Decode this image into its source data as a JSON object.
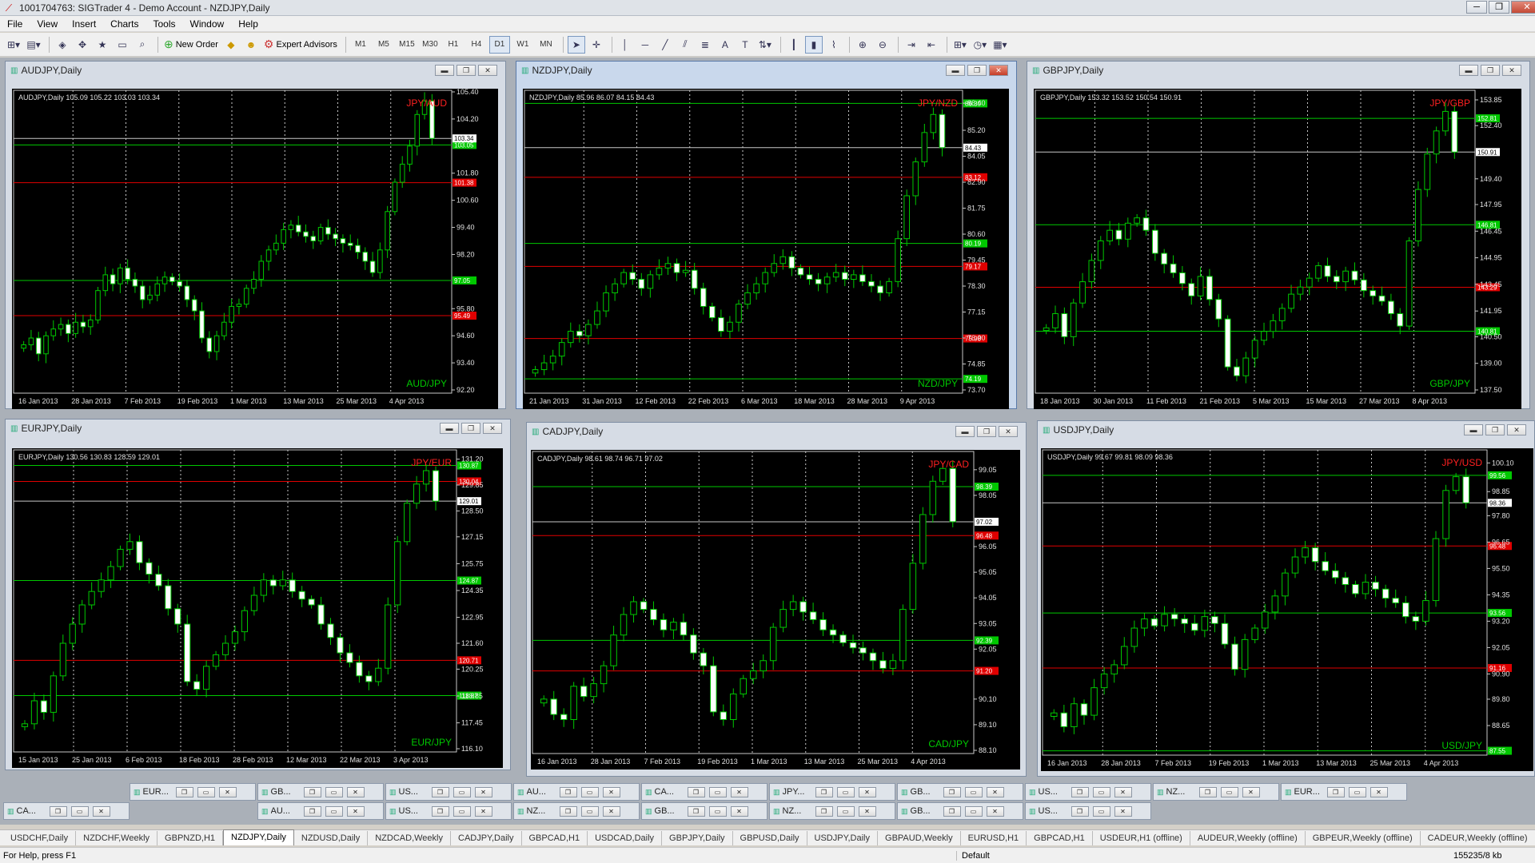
{
  "app": {
    "title": "1001704763: SIGTrader 4 - Demo Account - NZDJPY,Daily",
    "window_buttons": [
      "─",
      "❐",
      "✕"
    ]
  },
  "menu": [
    "File",
    "View",
    "Insert",
    "Charts",
    "Tools",
    "Window",
    "Help"
  ],
  "toolbar": {
    "new_order": "New Order",
    "expert_advisors": "Expert Advisors",
    "timeframes": [
      "M1",
      "M5",
      "M15",
      "M30",
      "H1",
      "H4",
      "D1",
      "W1",
      "MN"
    ],
    "active_timeframe": "D1"
  },
  "charts": [
    {
      "title": "AUDJPY,Daily",
      "info": "AUDJPY,Daily  105.09 105.22 103.03 103.34",
      "top_label": "JPY/AUD",
      "bottom_label": "AUD/JPY",
      "yticks": [
        "105.40",
        "104.20",
        "101.80",
        "100.60",
        "99.40",
        "98.20",
        "95.80",
        "94.60",
        "93.40",
        "92.20"
      ],
      "xticks": [
        "16 Jan 2013",
        "28 Jan 2013",
        "7 Feb 2013",
        "19 Feb 2013",
        "1 Mar 2013",
        "13 Mar 2013",
        "25 Mar 2013",
        "4 Apr 2013"
      ],
      "hlines": [
        {
          "v": "103.05",
          "c": "#00c800"
        },
        {
          "v": "101.38",
          "c": "#e00000"
        },
        {
          "v": "97.05",
          "c": "#00c800"
        },
        {
          "v": "95.49",
          "c": "#e00000"
        }
      ],
      "last": "103.34",
      "ymin": 92.2,
      "ymax": 105.4,
      "closes": [
        94.2,
        94.5,
        93.8,
        94.6,
        94.9,
        95.1,
        94.7,
        95.2,
        95.0,
        95.3,
        96.6,
        97.3,
        96.9,
        97.6,
        97.1,
        96.8,
        96.2,
        96.4,
        96.9,
        97.2,
        97.0,
        96.8,
        96.2,
        95.7,
        94.5,
        93.9,
        94.6,
        95.2,
        95.9,
        96.0,
        96.7,
        97.1,
        97.9,
        98.4,
        98.7,
        99.3,
        99.5,
        99.2,
        99.0,
        98.8,
        99.4,
        99.1,
        98.9,
        98.7,
        98.6,
        98.3,
        97.9,
        97.4,
        98.4,
        100.1,
        101.4,
        102.2,
        103.0,
        104.4,
        105.0,
        103.34
      ]
    },
    {
      "title": "NZDJPY,Daily",
      "info": "NZDJPY,Daily  85.96 86.07 84.15 84.43",
      "top_label": "JPY/NZD",
      "bottom_label": "NZD/JPY",
      "yticks": [
        "86.40",
        "85.20",
        "84.05",
        "82.90",
        "81.75",
        "80.60",
        "79.45",
        "78.30",
        "77.15",
        "76.00",
        "74.85",
        "73.70"
      ],
      "xticks": [
        "21 Jan 2013",
        "31 Jan 2013",
        "12 Feb 2013",
        "22 Feb 2013",
        "6 Mar 2013",
        "18 Mar 2013",
        "28 Mar 2013",
        "9 Apr 2013"
      ],
      "hlines": [
        {
          "v": "86.39",
          "c": "#00c800"
        },
        {
          "v": "83.12",
          "c": "#e00000"
        },
        {
          "v": "80.19",
          "c": "#00c800"
        },
        {
          "v": "79.17",
          "c": "#e00000"
        },
        {
          "v": "75.98",
          "c": "#e00000"
        },
        {
          "v": "74.19",
          "c": "#00c800"
        }
      ],
      "last": "84.43",
      "ymin": 73.7,
      "ymax": 86.9,
      "closes": [
        74.6,
        74.9,
        75.2,
        75.8,
        76.3,
        76.1,
        76.6,
        77.2,
        78.0,
        78.4,
        78.9,
        78.6,
        78.2,
        78.8,
        79.1,
        79.3,
        78.9,
        79.0,
        78.2,
        77.4,
        76.9,
        76.3,
        76.7,
        77.5,
        78.0,
        78.4,
        78.9,
        79.3,
        79.6,
        79.1,
        78.8,
        78.6,
        78.4,
        78.7,
        78.9,
        78.6,
        78.8,
        78.5,
        78.3,
        78.0,
        78.5,
        80.4,
        82.3,
        83.8,
        85.1,
        85.9,
        84.43
      ]
    },
    {
      "title": "GBPJPY,Daily",
      "info": "GBPJPY,Daily  153.32 153.52 150.54 150.91",
      "top_label": "JPY/GBP",
      "bottom_label": "GBP/JPY",
      "yticks": [
        "153.85",
        "152.40",
        "149.40",
        "147.95",
        "146.45",
        "144.95",
        "143.45",
        "141.95",
        "140.50",
        "139.00",
        "137.50"
      ],
      "xticks": [
        "18 Jan 2013",
        "30 Jan 2013",
        "11 Feb 2013",
        "21 Feb 2013",
        "5 Mar 2013",
        "15 Mar 2013",
        "27 Mar 2013",
        "8 Apr 2013"
      ],
      "hlines": [
        {
          "v": "152.81",
          "c": "#00c800"
        },
        {
          "v": "146.81",
          "c": "#00c800"
        },
        {
          "v": "143.29",
          "c": "#e00000"
        },
        {
          "v": "140.81",
          "c": "#00c800"
        }
      ],
      "last": "150.91",
      "ymin": 137.5,
      "ymax": 154.3,
      "closes": [
        141.0,
        141.8,
        140.5,
        142.4,
        143.6,
        144.8,
        145.9,
        146.5,
        146.0,
        146.9,
        147.2,
        146.5,
        145.2,
        144.6,
        144.1,
        143.5,
        142.8,
        143.9,
        142.6,
        141.5,
        138.8,
        138.3,
        139.3,
        140.3,
        140.8,
        141.4,
        142.1,
        142.9,
        143.3,
        143.8,
        144.5,
        143.9,
        143.6,
        144.2,
        143.7,
        143.1,
        142.8,
        142.5,
        141.8,
        141.1,
        145.9,
        148.8,
        150.8,
        152.1,
        153.2,
        150.91
      ]
    },
    {
      "title": "EURJPY,Daily",
      "info": "EURJPY,Daily  130.56 130.83 128.59 129.01",
      "top_label": "JPY/EUR",
      "bottom_label": "EUR/JPY",
      "yticks": [
        "131.20",
        "129.85",
        "128.50",
        "127.15",
        "125.75",
        "124.35",
        "122.95",
        "121.60",
        "120.25",
        "118.85",
        "117.45",
        "116.10"
      ],
      "xticks": [
        "15 Jan 2013",
        "25 Jan 2013",
        "6 Feb 2013",
        "18 Feb 2013",
        "28 Feb 2013",
        "12 Mar 2013",
        "22 Mar 2013",
        "3 Apr 2013"
      ],
      "hlines": [
        {
          "v": "130.87",
          "c": "#00c800"
        },
        {
          "v": "130.04",
          "c": "#e00000"
        },
        {
          "v": "124.87",
          "c": "#00c800"
        },
        {
          "v": "120.71",
          "c": "#e00000"
        },
        {
          "v": "118.87",
          "c": "#00c800"
        }
      ],
      "last": "129.01",
      "ymin": 116.1,
      "ymax": 131.6,
      "closes": [
        117.4,
        118.6,
        118.0,
        119.9,
        121.6,
        122.6,
        123.6,
        124.3,
        124.9,
        125.6,
        126.5,
        126.9,
        125.8,
        125.2,
        124.6,
        123.4,
        122.6,
        119.6,
        119.2,
        120.4,
        121.0,
        121.6,
        122.2,
        123.3,
        124.1,
        124.9,
        124.6,
        124.9,
        124.3,
        123.9,
        123.6,
        122.6,
        121.9,
        121.1,
        120.6,
        119.9,
        119.6,
        120.3,
        123.6,
        126.9,
        128.9,
        129.9,
        130.6,
        129.01
      ]
    },
    {
      "title": "CADJPY,Daily",
      "info": "CADJPY,Daily  98.61 98.74 96.71 97.02",
      "top_label": "JPY/CAD",
      "bottom_label": "CAD/JPY",
      "yticks": [
        "99.05",
        "98.05",
        "96.05",
        "95.05",
        "94.05",
        "93.05",
        "92.05",
        "90.10",
        "89.10",
        "88.10"
      ],
      "xticks": [
        "16 Jan 2013",
        "28 Jan 2013",
        "7 Feb 2013",
        "19 Feb 2013",
        "1 Mar 2013",
        "13 Mar 2013",
        "25 Mar 2013",
        "4 Apr 2013"
      ],
      "hlines": [
        {
          "v": "98.39",
          "c": "#00c800"
        },
        {
          "v": "96.48",
          "c": "#e00000"
        },
        {
          "v": "92.39",
          "c": "#00c800"
        },
        {
          "v": "91.20",
          "c": "#e00000"
        }
      ],
      "last": "97.02",
      "ymin": 88.1,
      "ymax": 99.7,
      "closes": [
        90.1,
        89.5,
        89.3,
        90.6,
        90.2,
        90.7,
        91.4,
        92.6,
        93.4,
        93.9,
        93.6,
        93.2,
        92.8,
        93.1,
        92.6,
        91.9,
        91.4,
        89.6,
        89.3,
        90.3,
        90.9,
        91.2,
        91.6,
        92.9,
        93.6,
        93.9,
        93.5,
        93.2,
        92.8,
        92.6,
        92.3,
        92.1,
        91.9,
        91.6,
        91.3,
        91.6,
        93.6,
        95.4,
        97.3,
        98.6,
        99.1,
        97.02
      ]
    },
    {
      "title": "USDJPY,Daily",
      "info": "USDJPY,Daily  99.67 99.81 98.09 98.36",
      "top_label": "JPY/USD",
      "bottom_label": "USD/JPY",
      "yticks": [
        "100.10",
        "98.85",
        "97.80",
        "96.65",
        "95.50",
        "94.35",
        "93.20",
        "92.05",
        "90.90",
        "89.80",
        "88.65"
      ],
      "xticks": [
        "16 Jan 2013",
        "28 Jan 2013",
        "7 Feb 2013",
        "19 Feb 2013",
        "1 Mar 2013",
        "13 Mar 2013",
        "25 Mar 2013",
        "4 Apr 2013"
      ],
      "hlines": [
        {
          "v": "99.56",
          "c": "#00c800"
        },
        {
          "v": "96.48",
          "c": "#e00000"
        },
        {
          "v": "93.56",
          "c": "#00c800"
        },
        {
          "v": "91.16",
          "c": "#e00000"
        },
        {
          "v": "87.55",
          "c": "#00c800"
        }
      ],
      "last": "98.36",
      "ymin": 87.5,
      "ymax": 100.6,
      "closes": [
        89.2,
        88.6,
        89.6,
        89.1,
        90.3,
        90.9,
        91.3,
        92.1,
        92.9,
        93.3,
        93.0,
        93.5,
        93.3,
        93.1,
        92.8,
        93.4,
        93.1,
        92.2,
        91.1,
        92.4,
        92.9,
        93.6,
        94.3,
        95.3,
        96.0,
        96.4,
        95.8,
        95.4,
        95.1,
        94.8,
        94.4,
        94.9,
        94.6,
        94.2,
        94.0,
        93.4,
        93.2,
        94.1,
        96.8,
        98.9,
        99.5,
        98.36
      ]
    }
  ],
  "minimized": [
    [
      "EUR...",
      "GB...",
      "US...",
      "AU...",
      "CA...",
      "JPY...",
      "GB...",
      "US...",
      "NZ...",
      "EUR..."
    ],
    [
      "CA...",
      "AU...",
      "US...",
      "NZ...",
      "GB...",
      "NZ...",
      "GB...",
      "US..."
    ]
  ],
  "tabs": [
    "USDCHF,Daily",
    "NZDCHF,Weekly",
    "GBPNZD,H1",
    "NZDJPY,Daily",
    "NZDUSD,Daily",
    "NZDCAD,Weekly",
    "CADJPY,Daily",
    "GBPCAD,H1",
    "USDCAD,Daily",
    "GBPJPY,Daily",
    "GBPUSD,Daily",
    "USDJPY,Daily",
    "GBPAUD,Weekly",
    "EURUSD,H1",
    "GBPCAD,H1",
    "USDEUR,H1 (offline)",
    "AUDEUR,Weekly (offline)",
    "GBPEUR,Weekly (offline)",
    "CADEUR,Weekly (offline)"
  ],
  "active_tab": "NZDJPY,Daily",
  "status": {
    "help": "For Help, press F1",
    "profile": "Default",
    "traffic": "155235/8 kb"
  },
  "colors": {
    "bull": "#00c800",
    "bear": "#ffffff",
    "support": "#00c800",
    "resistance": "#e00000",
    "label": "#ff2020",
    "grid": "#c8c8c8"
  }
}
